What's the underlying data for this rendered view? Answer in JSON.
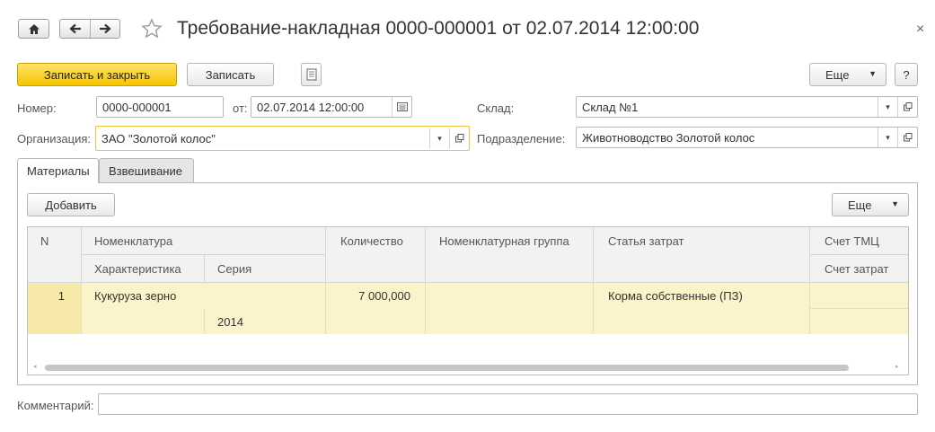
{
  "header": {
    "title": "Требование-накладная 0000-000001 от 02.07.2014 12:00:00",
    "home_icon": "home-icon",
    "back_icon": "arrow-left-icon",
    "forward_icon": "arrow-right-icon",
    "star_icon": "star-icon",
    "close_icon": "close-icon"
  },
  "toolbar": {
    "save_close_label": "Записать и закрыть",
    "save_label": "Записать",
    "more_label": "Еще",
    "help_label": "?",
    "report_icon": "document-report-icon"
  },
  "form": {
    "number_label": "Номер:",
    "number_value": "0000-000001",
    "date_label": "от:",
    "date_value": "02.07.2014 12:00:00",
    "warehouse_label": "Склад:",
    "warehouse_value": "Склад №1",
    "org_label": "Организация:",
    "org_value": "ЗАО \"Золотой колос\"",
    "dept_label": "Подразделение:",
    "dept_value": "Животноводство Золотой колос",
    "comment_label": "Комментарий:",
    "comment_value": ""
  },
  "tabs": [
    {
      "label": "Материалы",
      "active": true
    },
    {
      "label": "Взвешивание",
      "active": false
    }
  ],
  "table_toolbar": {
    "add_label": "Добавить",
    "more_label": "Еще"
  },
  "table": {
    "headers": {
      "n": "N",
      "nomenclature": "Номенклатура",
      "characteristic": "Характеристика",
      "series": "Серия",
      "quantity": "Количество",
      "nomenclature_group": "Номенклатурная группа",
      "cost_item": "Статья затрат",
      "tmc_account": "Счет ТМЦ",
      "cost_account": "Счет затрат"
    },
    "rows": [
      {
        "n": "1",
        "nomenclature": "Кукуруза зерно",
        "characteristic": "",
        "series": "2014",
        "quantity": "7 000,000",
        "nomenclature_group": "",
        "cost_item": "Корма собственные (ПЗ)",
        "tmc_account": "",
        "cost_account": ""
      }
    ]
  }
}
